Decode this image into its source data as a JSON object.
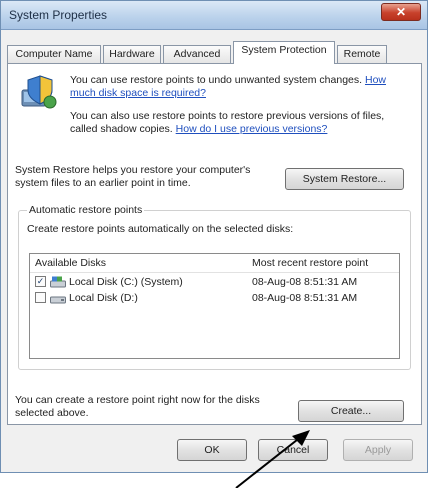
{
  "window": {
    "title": "System Properties",
    "close_glyph": "✕"
  },
  "tabs": [
    {
      "label": "Computer Name"
    },
    {
      "label": "Hardware"
    },
    {
      "label": "Advanced"
    },
    {
      "label": "System Protection",
      "active": true
    },
    {
      "label": "Remote"
    }
  ],
  "intro": {
    "line1_text": "You can use restore points to undo unwanted system changes. ",
    "line1_link": "How much disk space is required?",
    "line2_text": "You can also use restore points to restore previous versions of files, called shadow copies. ",
    "line2_link": "How do I use previous versions?",
    "icon": "system-protection-shield-icon"
  },
  "restore": {
    "text": "System Restore helps you restore your computer's system files to an earlier point in time.",
    "button_label": "System Restore..."
  },
  "auto_restore": {
    "group_title": "Automatic restore points",
    "description": "Create restore points automatically on the selected disks:",
    "columns": [
      "Available Disks",
      "Most recent restore point"
    ],
    "disks": [
      {
        "checked": true,
        "icon": "system-drive-icon",
        "name": "Local Disk (C:) (System)",
        "last_point": "08-Aug-08 8:51:31 AM"
      },
      {
        "checked": false,
        "icon": "drive-icon",
        "name": "Local Disk (D:)",
        "last_point": "08-Aug-08 8:51:31 AM"
      }
    ]
  },
  "create": {
    "text": "You can create a restore point right now for the disks selected above.",
    "button_label": "Create..."
  },
  "footer": {
    "ok_label": "OK",
    "cancel_label": "Cancel",
    "apply_label": "Apply"
  },
  "colors": {
    "link": "#1f4fbe",
    "title_bar": "#bcd3ec",
    "close_button": "#c8412c"
  }
}
